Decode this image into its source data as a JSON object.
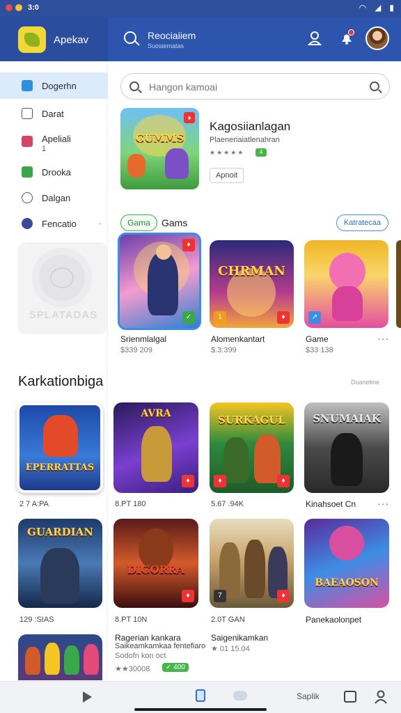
{
  "status": {
    "time": "3:0"
  },
  "appbar": {
    "brand": "Apekav",
    "title": "Reociaiiem",
    "subtitle": "Suosiematas",
    "icons": [
      "search-icon",
      "user-icon",
      "notification-icon",
      "avatar"
    ]
  },
  "sidebar": {
    "items": [
      {
        "label": "Dogerhn",
        "sub": "",
        "icon": "chat-icon",
        "color": "#2d8fe0",
        "active": true
      },
      {
        "label": "Darat",
        "sub": "",
        "icon": "bag-icon",
        "color": "#555555",
        "active": false
      },
      {
        "label": "Apeliali",
        "sub": "1",
        "icon": "close-square-icon",
        "color": "#d9436b",
        "active": false
      },
      {
        "label": "Drooka",
        "sub": "",
        "icon": "play-square-icon",
        "color": "#3aa84a",
        "active": false
      },
      {
        "label": "Dalgan",
        "sub": "",
        "icon": "puzzle-icon",
        "color": "#555555",
        "active": false
      },
      {
        "label": "Fencatio",
        "sub": "",
        "icon": "y-circle-icon",
        "color": "#3b4a9c",
        "active": false,
        "chevron": "-"
      }
    ],
    "promo_text": "SPLATADAS"
  },
  "search": {
    "placeholder": "Hangon kamoai"
  },
  "featured": {
    "title": "Kagosiianlagan",
    "subtitle": "Plaeneriaiatlenahran",
    "rating": "★★★★★",
    "badge": "4",
    "button": "Apnoit"
  },
  "games_row": {
    "chip": "Gama",
    "title": "Gams",
    "more": "Katratecaa",
    "items": [
      {
        "title": "Srienmlalgal",
        "price": "$339 209",
        "art": "wizard",
        "colors": [
          "#6b3fa8",
          "#f59bd0",
          "#2f7fd1"
        ]
      },
      {
        "title": "Alomenkantart",
        "price": "$.3:399",
        "art": "CHRMAN",
        "colors": [
          "#2b2a7a",
          "#f3a53b",
          "#b53d8c"
        ]
      },
      {
        "title": "Game",
        "price": "$33 138",
        "art": "creature",
        "colors": [
          "#f0b624",
          "#f36fb3",
          "#e44fa0"
        ]
      }
    ]
  },
  "recommend": {
    "title": "Karkationbiga",
    "link": "Duanetine",
    "items": [
      {
        "title": "2 7 A:PA",
        "price": "",
        "art": "EPERRATTAS",
        "colors": [
          "#1e4aa8",
          "#e24a2a",
          "#f5a623"
        ]
      },
      {
        "title": "8.PT 180",
        "price": "",
        "art": "AVRA",
        "colors": [
          "#2a1a5a",
          "#7a3fd1",
          "#f5a623"
        ]
      },
      {
        "title": "5.67 .94K",
        "price": "",
        "art": "SURKAGUL",
        "colors": [
          "#2e8a3d",
          "#f5c623",
          "#d35a2a"
        ]
      },
      {
        "title": "Kinahsoet Cn",
        "price": "",
        "art": "SNUMAIAK",
        "colors": [
          "#3a3a3a",
          "#8a8a8a",
          "#c0c0c0"
        ]
      },
      {
        "title": "129 :SIAS",
        "price": "",
        "art": "GUARDIAN",
        "colors": [
          "#1e3a6a",
          "#4a7ab5",
          "#f5c623"
        ]
      },
      {
        "title": "8.PT 10N",
        "price": "",
        "art": "DIGORRA",
        "colors": [
          "#5a1a1a",
          "#d35a2a",
          "#f5a623"
        ]
      },
      {
        "title": "2.0T GAN",
        "price": "",
        "art": "warriors",
        "colors": [
          "#6a5a3a",
          "#c9a56b",
          "#f5e2b0"
        ]
      },
      {
        "title": "Panekaolonpet",
        "price": "",
        "art": "BAEAOSON",
        "colors": [
          "#5a2a9a",
          "#d94fa0",
          "#f5c623"
        ]
      }
    ],
    "extra": {
      "title": "Ragerian kankara",
      "subtitle": "Saikeamkamkaa fentefiaro",
      "meta": "Sodofn kon oct",
      "rating": "★★30008",
      "badge": "✓ 400"
    },
    "extra2": {
      "title": "Saigenikamkan",
      "meta": "★ 01 15.04"
    }
  },
  "bottom_nav": {
    "label": "Saplik",
    "icons": [
      "play-icon",
      "home-icon",
      "chat-icon",
      "calendar-icon",
      "profile-icon"
    ]
  }
}
